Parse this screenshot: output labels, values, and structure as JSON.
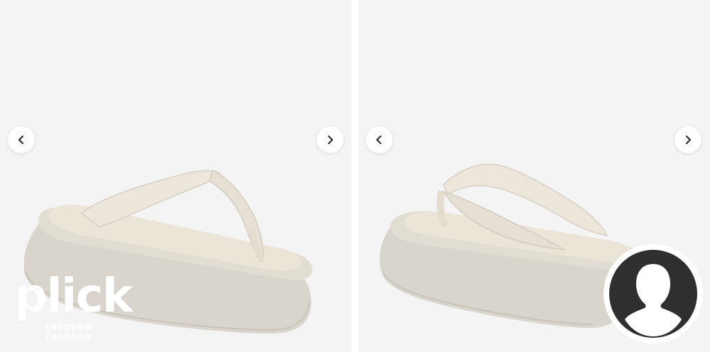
{
  "gallery": {
    "images": [
      {
        "description": "cream platform flip-flop sandal, front three-quarter view"
      },
      {
        "description": "cream platform flip-flop sandal, back three-quarter view"
      }
    ],
    "nav": {
      "prev_icon": "chevron-left-icon",
      "next_icon": "chevron-right-icon"
    }
  },
  "watermark": {
    "brand": "plick",
    "tagline": "reloved fashion"
  },
  "avatar": {
    "icon": "user-silhouette-icon"
  },
  "colors": {
    "panel_bg": "#f4f4f5",
    "sole": "#dcd8d0",
    "footbed": "#ebe5d8",
    "strap": "#ece6db",
    "avatar_bg": "#2f2f2f"
  }
}
